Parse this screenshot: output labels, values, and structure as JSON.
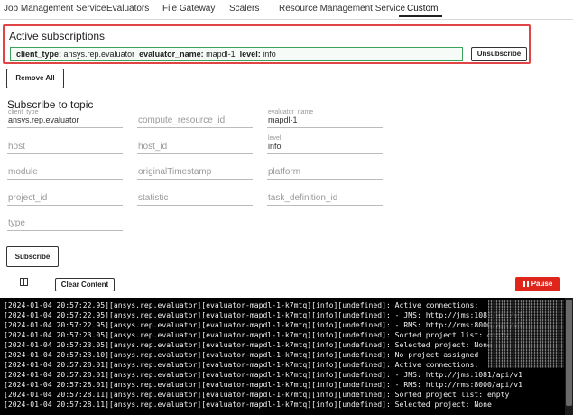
{
  "tabs": [
    {
      "label": "Job Management Service"
    },
    {
      "label": "Evaluators"
    },
    {
      "label": "File Gateway"
    },
    {
      "label": "Scalers"
    },
    {
      "label": "Resource Management Service"
    },
    {
      "label": "Custom",
      "active": true
    }
  ],
  "active_subscriptions": {
    "title": "Active subscriptions",
    "items": [
      {
        "k1": "client_type:",
        "v1": "ansys.rep.evaluator",
        "k2": "evaluator_name:",
        "v2": "mapdl-1",
        "k3": "level:",
        "v3": "info",
        "unsubscribe_label": "Unsubscribe"
      }
    ]
  },
  "remove_all_label": "Remove All",
  "subscribe": {
    "title": "Subscribe to topic",
    "fields": [
      {
        "name": "client_type",
        "value": "ansys.rep.evaluator"
      },
      {
        "name": "compute_resource_id",
        "value": ""
      },
      {
        "name": "evaluator_name",
        "value": "mapdl-1"
      },
      {
        "name": "host",
        "value": ""
      },
      {
        "name": "host_id",
        "value": ""
      },
      {
        "name": "level",
        "value": "info"
      },
      {
        "name": "module",
        "value": ""
      },
      {
        "name": "originalTimestamp",
        "value": ""
      },
      {
        "name": "platform",
        "value": ""
      },
      {
        "name": "project_id",
        "value": ""
      },
      {
        "name": "statistic",
        "value": ""
      },
      {
        "name": "task_definition_id",
        "value": ""
      },
      {
        "name": "type",
        "value": ""
      }
    ],
    "button_label": "Subscribe"
  },
  "console_controls": {
    "clear_label": "Clear Content",
    "pause_label": "Pause"
  },
  "log_lines": [
    "[2024-01-04 20:57:22.95][ansys.rep.evaluator][evaluator-mapdl-1-k7mtq][info][undefined]: Active connections:",
    "[2024-01-04 20:57:22.95][ansys.rep.evaluator][evaluator-mapdl-1-k7mtq][info][undefined]: - JMS: http://jms:1081/api/v1",
    "[2024-01-04 20:57:22.95][ansys.rep.evaluator][evaluator-mapdl-1-k7mtq][info][undefined]: - RMS: http://rms:8000/api/v1",
    "[2024-01-04 20:57:23.05][ansys.rep.evaluator][evaluator-mapdl-1-k7mtq][info][undefined]: Sorted project list: empty",
    "[2024-01-04 20:57:23.05][ansys.rep.evaluator][evaluator-mapdl-1-k7mtq][info][undefined]: Selected project: None",
    "[2024-01-04 20:57:23.10][ansys.rep.evaluator][evaluator-mapdl-1-k7mtq][info][undefined]: No project assigned",
    "[2024-01-04 20:57:28.01][ansys.rep.evaluator][evaluator-mapdl-1-k7mtq][info][undefined]: Active connections:",
    "[2024-01-04 20:57:28.01][ansys.rep.evaluator][evaluator-mapdl-1-k7mtq][info][undefined]: - JMS: http://jms:1081/api/v1",
    "[2024-01-04 20:57:28.01][ansys.rep.evaluator][evaluator-mapdl-1-k7mtq][info][undefined]: - RMS: http://rms:8000/api/v1",
    "[2024-01-04 20:57:28.11][ansys.rep.evaluator][evaluator-mapdl-1-k7mtq][info][undefined]: Sorted project list: empty",
    "[2024-01-04 20:57:28.11][ansys.rep.evaluator][evaluator-mapdl-1-k7mtq][info][undefined]: Selected project: None"
  ]
}
